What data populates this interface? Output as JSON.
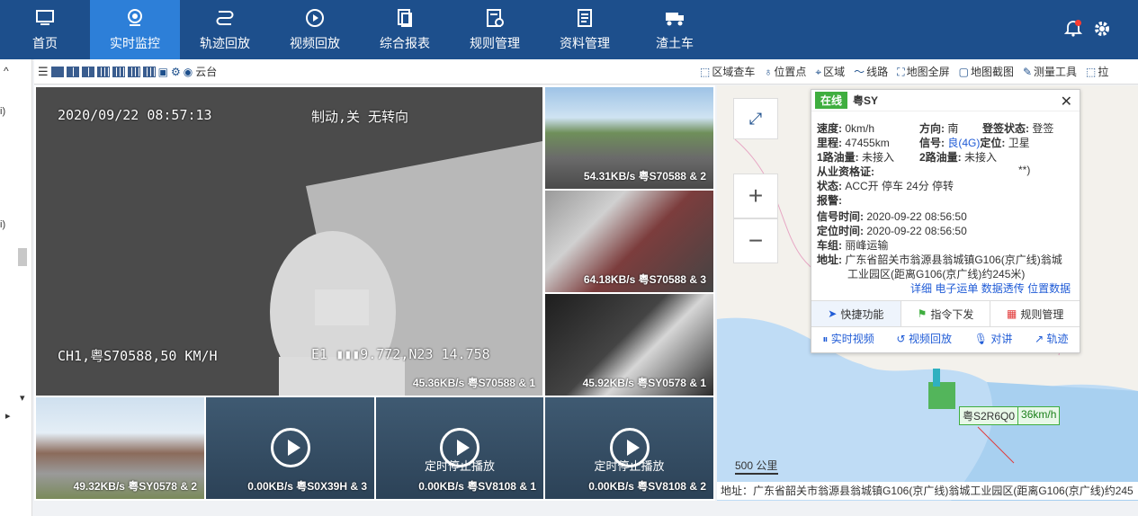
{
  "nav": {
    "items": [
      {
        "label": "首页",
        "icon": "monitor-icon"
      },
      {
        "label": "实时监控",
        "icon": "webcam-icon",
        "active": true
      },
      {
        "label": "轨迹回放",
        "icon": "route-icon"
      },
      {
        "label": "视频回放",
        "icon": "play-circle-icon"
      },
      {
        "label": "综合报表",
        "icon": "report-icon"
      },
      {
        "label": "规则管理",
        "icon": "rules-icon"
      },
      {
        "label": "资料管理",
        "icon": "document-icon"
      },
      {
        "label": "渣土车",
        "icon": "truck-icon"
      }
    ]
  },
  "toolbar": {
    "ptz_label": "云台",
    "right": [
      "区域查车",
      "位置点",
      "区域",
      "线路",
      "地图全屏",
      "地图截图",
      "测量工具",
      "拉"
    ]
  },
  "videos": {
    "main": {
      "timestamp": "2020/09/22 08:57:13",
      "overlay_top": "制动,关 无转向",
      "overlay_bottom_left": "CH1,粤S70588,50 KM/H",
      "overlay_bottom_right": "E1 ▮▮▮9.772,N23 14.758",
      "label": "45.36KB/s 粤S70588 & 1"
    },
    "r1": {
      "label": "54.31KB/s 粤S70588 & 2"
    },
    "r2": {
      "label": "64.18KB/s 粤S70588 & 3"
    },
    "r3": {
      "label": "45.92KB/s 粤SY0578 & 1"
    },
    "b1": {
      "label": "49.32KB/s 粤SY0578 & 2"
    },
    "b2": {
      "label": "0.00KB/s 粤S0X39H & 3",
      "status": ""
    },
    "b3": {
      "label": "0.00KB/s 粤SV8108 & 1",
      "status": "定时停止播放"
    },
    "b4": {
      "label": "0.00KB/s 粤SV8108 & 2",
      "status": "定时停止播放"
    }
  },
  "popup": {
    "status": "在线",
    "plate": "粤SY",
    "speed_label": "速度:",
    "speed": "0km/h",
    "direction_label": "方向:",
    "direction": "南",
    "signin_label": "登签状态:",
    "signin": "登签",
    "mileage_label": "里程:",
    "mileage": "47455km",
    "signal_label": "信号:",
    "signal": "良(4G)",
    "locate_label": "定位:",
    "locate": "卫星",
    "oil1_label": "1路油量:",
    "oil1": "未接入",
    "oil2_label": "2路油量:",
    "oil2": "未接入",
    "cert_label": "从业资格证:",
    "cert": "**)",
    "state_label": "状态:",
    "state": "ACC开 停车 24分 停转",
    "alarm_label": "报警:",
    "signal_time_label": "信号时间:",
    "signal_time": "2020-09-22 08:56:50",
    "locate_time_label": "定位时间:",
    "locate_time": "2020-09-22 08:56:50",
    "team_label": "车组:",
    "team": "丽峰运输",
    "address_label": "地址:",
    "address_line1": "广东省韶关市翁源县翁城镇G106(京广线)翁城",
    "address_line2": "工业园区(距离G106(京广线)约245米)",
    "links": [
      "详细",
      "电子运单",
      "数据透传",
      "位置数据"
    ],
    "tabs": [
      "快捷功能",
      "指令下发",
      "规则管理"
    ],
    "actions": [
      "实时视频",
      "视频回放",
      "对讲",
      "轨迹"
    ]
  },
  "map": {
    "scale": "500 公里",
    "vehicle_plate": "粤S2R6Q0",
    "vehicle_speed": "36km/h",
    "bottom_address": "地址：广东省韶关市翁源县翁城镇G106(京广线)翁城工业园区(距离G106(京广线)约245"
  },
  "colors": {
    "nav_bg": "#1d4f8c",
    "nav_active": "#2d7fd8",
    "online": "#3fae3f"
  }
}
